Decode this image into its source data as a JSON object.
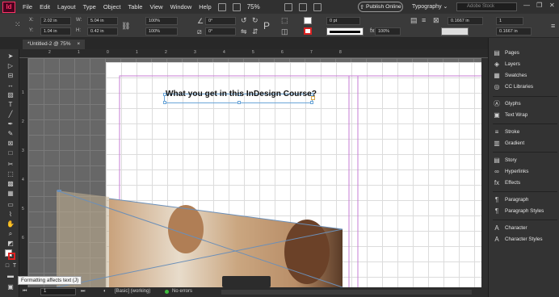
{
  "app": {
    "logo": "Id",
    "menus": [
      "File",
      "Edit",
      "Layout",
      "Type",
      "Object",
      "Table",
      "View",
      "Window",
      "Help"
    ],
    "zoom": "75%",
    "publish_label": "Publish Online",
    "workspace": "Typography",
    "search_placeholder": "Adobe Stock",
    "window_controls": [
      "—",
      "❐",
      "✕"
    ]
  },
  "control": {
    "x_label": "X:",
    "x_value": "2.02 in",
    "y_label": "Y:",
    "y_value": "1.04 in",
    "w_label": "W:",
    "w_value": "5.04 in",
    "h_label": "H:",
    "h_value": "0.42 in",
    "scale_x": "100%",
    "scale_y": "100%",
    "rotate": "0°",
    "shear": "0°",
    "stroke_weight": "0 pt",
    "opacity": "100%",
    "offset_1": "0.1667 in",
    "offset_2": "0.1667 in",
    "columns": "1"
  },
  "document": {
    "tab_title": "*Untitled-2 @ 75%",
    "headline": "What you get in this InDesign Course?"
  },
  "rulers": {
    "h": [
      "2",
      "1",
      "0",
      "1",
      "2",
      "3",
      "4",
      "5",
      "6",
      "7",
      "8"
    ],
    "v": [
      "1",
      "2",
      "3",
      "4",
      "5",
      "6"
    ]
  },
  "status": {
    "page": "1",
    "style": "[Basic] (working)",
    "errors": "No errors"
  },
  "tooltip": "Formatting affects text (J)",
  "panels": [
    {
      "icon": "pages-icon",
      "glyph": "▤",
      "label": "Pages"
    },
    {
      "icon": "layers-icon",
      "glyph": "◈",
      "label": "Layers"
    },
    {
      "icon": "swatches-icon",
      "glyph": "▦",
      "label": "Swatches"
    },
    {
      "icon": "cc-libraries-icon",
      "glyph": "◎",
      "label": "CC Libraries"
    },
    {
      "icon": "glyphs-icon",
      "glyph": "Ⓐ",
      "label": "Glyphs"
    },
    {
      "icon": "text-wrap-icon",
      "glyph": "▣",
      "label": "Text Wrap"
    },
    {
      "icon": "stroke-icon",
      "glyph": "≡",
      "label": "Stroke"
    },
    {
      "icon": "gradient-icon",
      "glyph": "▥",
      "label": "Gradient"
    },
    {
      "icon": "story-icon",
      "glyph": "▤",
      "label": "Story"
    },
    {
      "icon": "hyperlinks-icon",
      "glyph": "∞",
      "label": "Hyperlinks"
    },
    {
      "icon": "effects-icon",
      "glyph": "fx",
      "label": "Effects"
    },
    {
      "icon": "paragraph-icon",
      "glyph": "¶",
      "label": "Paragraph"
    },
    {
      "icon": "paragraph-styles-icon",
      "glyph": "¶",
      "label": "Paragraph Styles"
    },
    {
      "icon": "character-icon",
      "glyph": "A",
      "label": "Character"
    },
    {
      "icon": "character-styles-icon",
      "glyph": "A",
      "label": "Character Styles"
    }
  ]
}
